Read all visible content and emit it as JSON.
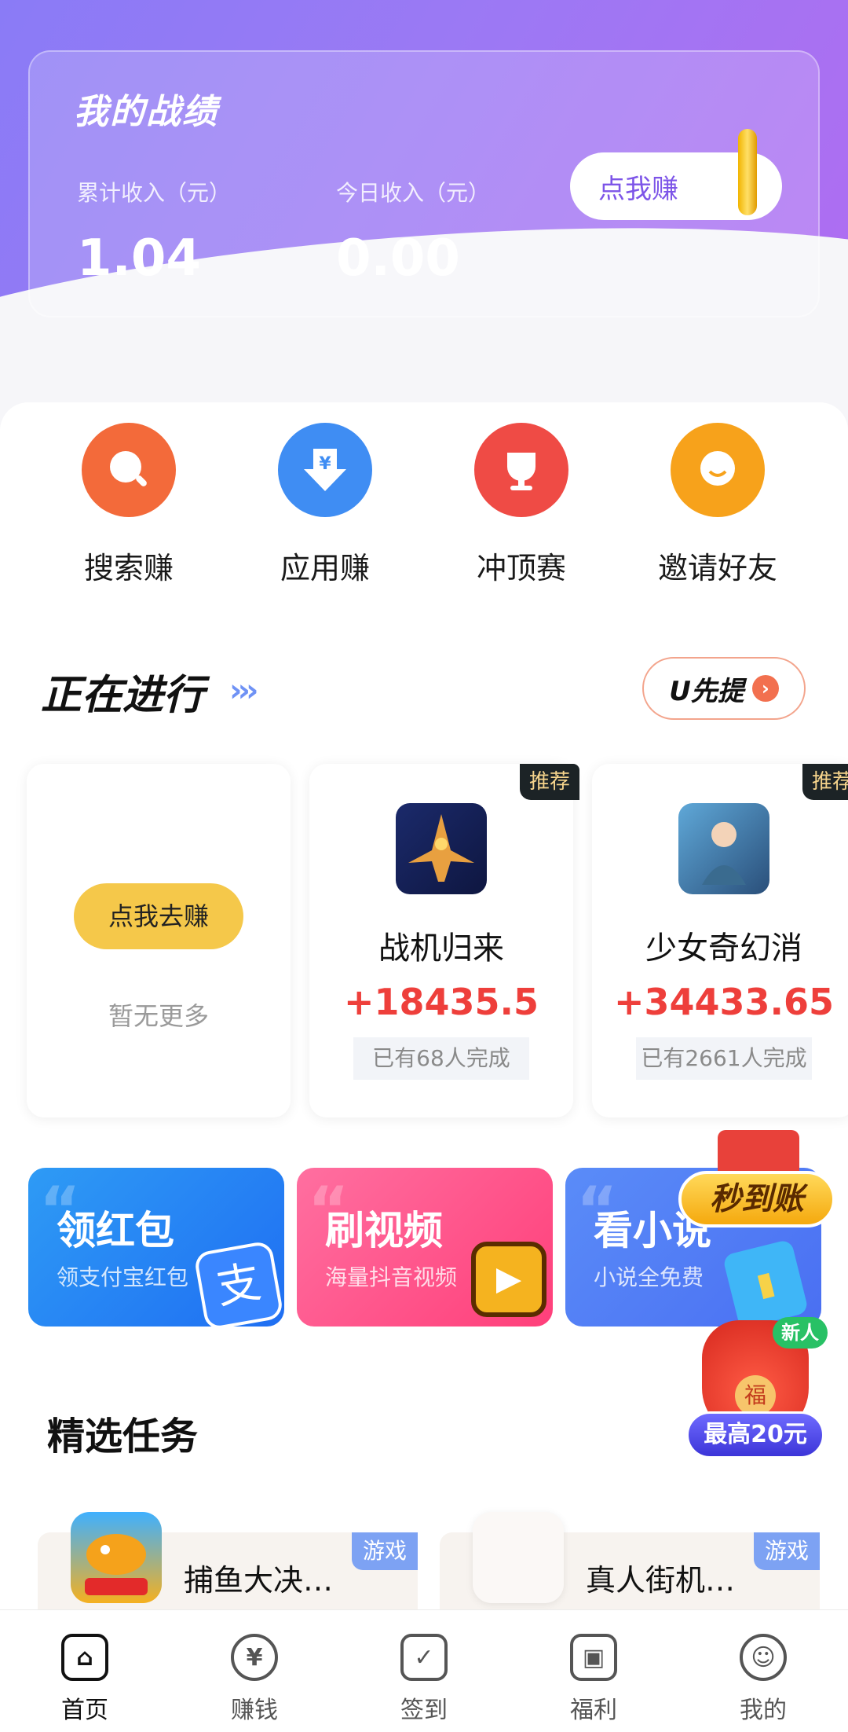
{
  "header": {
    "title": "我的战绩",
    "total_label": "累计收入（元）",
    "total_value": "1.04",
    "today_label": "今日收入（元）",
    "today_value": "0.00",
    "earn_button": "点我赚"
  },
  "quick_actions": [
    {
      "label": "搜索赚",
      "icon": "search-icon",
      "color": "#f36a3a"
    },
    {
      "label": "应用赚",
      "icon": "download-yuan-icon",
      "color": "#3f8df3"
    },
    {
      "label": "冲顶赛",
      "icon": "trophy-icon",
      "color": "#ef4b45"
    },
    {
      "label": "邀请好友",
      "icon": "friend-icon",
      "color": "#f7a21b"
    }
  ],
  "ongoing": {
    "title": "正在进行",
    "chevrons": "›››",
    "utx_label": "U先提",
    "utx_arrow": "›",
    "empty_card": {
      "button": "点我去赚",
      "text": "暂无更多"
    },
    "cards": [
      {
        "tag": "推荐",
        "name": "战机归来",
        "reward": "+18435.5",
        "done": "已有68人完成"
      },
      {
        "tag": "推荐",
        "name": "少女奇幻消",
        "reward": "+34433.65",
        "done": "已有2661人完成"
      }
    ]
  },
  "promos": [
    {
      "title": "领红包",
      "sub": "领支付宝红包",
      "glyph": "支"
    },
    {
      "title": "刷视频",
      "sub": "海量抖音视频",
      "glyph": "▶"
    },
    {
      "title": "看小说",
      "sub": "小说全免费",
      "glyph": "▮"
    }
  ],
  "floating": {
    "arrive": "秒到账",
    "new_tag": "新人",
    "bag_glyph": "福",
    "max_reward": "最高20元"
  },
  "featured": {
    "title": "精选任务",
    "items": [
      {
        "tag": "游戏",
        "name": "捕鱼大决…"
      },
      {
        "tag": "游戏",
        "name": "真人街机…"
      }
    ]
  },
  "nav": [
    {
      "label": "首页",
      "glyph": "⌂"
    },
    {
      "label": "赚钱",
      "glyph": "¥"
    },
    {
      "label": "签到",
      "glyph": "✓"
    },
    {
      "label": "福利",
      "glyph": "▣"
    },
    {
      "label": "我的",
      "glyph": "☺"
    }
  ],
  "colors": {
    "accent": "#8a7bf6",
    "reward": "#ee3f3b"
  }
}
